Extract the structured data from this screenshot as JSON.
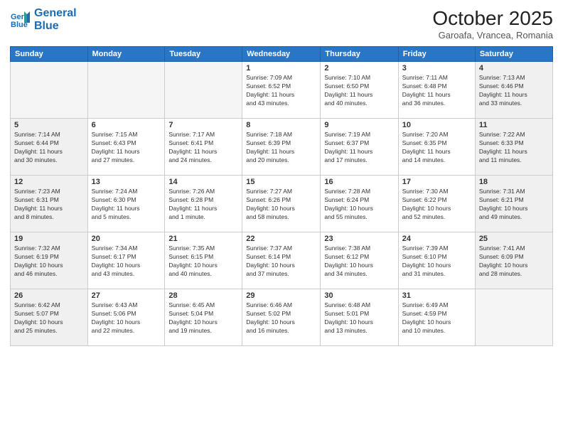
{
  "logo": {
    "line1": "General",
    "line2": "Blue"
  },
  "title": "October 2025",
  "location": "Garoafa, Vrancea, Romania",
  "headers": [
    "Sunday",
    "Monday",
    "Tuesday",
    "Wednesday",
    "Thursday",
    "Friday",
    "Saturday"
  ],
  "weeks": [
    [
      {
        "day": "",
        "info": "",
        "empty": true
      },
      {
        "day": "",
        "info": "",
        "empty": true
      },
      {
        "day": "",
        "info": "",
        "empty": true
      },
      {
        "day": "1",
        "info": "Sunrise: 7:09 AM\nSunset: 6:52 PM\nDaylight: 11 hours\nand 43 minutes."
      },
      {
        "day": "2",
        "info": "Sunrise: 7:10 AM\nSunset: 6:50 PM\nDaylight: 11 hours\nand 40 minutes."
      },
      {
        "day": "3",
        "info": "Sunrise: 7:11 AM\nSunset: 6:48 PM\nDaylight: 11 hours\nand 36 minutes."
      },
      {
        "day": "4",
        "info": "Sunrise: 7:13 AM\nSunset: 6:46 PM\nDaylight: 11 hours\nand 33 minutes.",
        "weekend": true
      }
    ],
    [
      {
        "day": "5",
        "info": "Sunrise: 7:14 AM\nSunset: 6:44 PM\nDaylight: 11 hours\nand 30 minutes.",
        "weekend": true
      },
      {
        "day": "6",
        "info": "Sunrise: 7:15 AM\nSunset: 6:43 PM\nDaylight: 11 hours\nand 27 minutes."
      },
      {
        "day": "7",
        "info": "Sunrise: 7:17 AM\nSunset: 6:41 PM\nDaylight: 11 hours\nand 24 minutes."
      },
      {
        "day": "8",
        "info": "Sunrise: 7:18 AM\nSunset: 6:39 PM\nDaylight: 11 hours\nand 20 minutes."
      },
      {
        "day": "9",
        "info": "Sunrise: 7:19 AM\nSunset: 6:37 PM\nDaylight: 11 hours\nand 17 minutes."
      },
      {
        "day": "10",
        "info": "Sunrise: 7:20 AM\nSunset: 6:35 PM\nDaylight: 11 hours\nand 14 minutes."
      },
      {
        "day": "11",
        "info": "Sunrise: 7:22 AM\nSunset: 6:33 PM\nDaylight: 11 hours\nand 11 minutes.",
        "weekend": true
      }
    ],
    [
      {
        "day": "12",
        "info": "Sunrise: 7:23 AM\nSunset: 6:31 PM\nDaylight: 11 hours\nand 8 minutes.",
        "weekend": true
      },
      {
        "day": "13",
        "info": "Sunrise: 7:24 AM\nSunset: 6:30 PM\nDaylight: 11 hours\nand 5 minutes."
      },
      {
        "day": "14",
        "info": "Sunrise: 7:26 AM\nSunset: 6:28 PM\nDaylight: 11 hours\nand 1 minute."
      },
      {
        "day": "15",
        "info": "Sunrise: 7:27 AM\nSunset: 6:26 PM\nDaylight: 10 hours\nand 58 minutes."
      },
      {
        "day": "16",
        "info": "Sunrise: 7:28 AM\nSunset: 6:24 PM\nDaylight: 10 hours\nand 55 minutes."
      },
      {
        "day": "17",
        "info": "Sunrise: 7:30 AM\nSunset: 6:22 PM\nDaylight: 10 hours\nand 52 minutes."
      },
      {
        "day": "18",
        "info": "Sunrise: 7:31 AM\nSunset: 6:21 PM\nDaylight: 10 hours\nand 49 minutes.",
        "weekend": true
      }
    ],
    [
      {
        "day": "19",
        "info": "Sunrise: 7:32 AM\nSunset: 6:19 PM\nDaylight: 10 hours\nand 46 minutes.",
        "weekend": true
      },
      {
        "day": "20",
        "info": "Sunrise: 7:34 AM\nSunset: 6:17 PM\nDaylight: 10 hours\nand 43 minutes."
      },
      {
        "day": "21",
        "info": "Sunrise: 7:35 AM\nSunset: 6:15 PM\nDaylight: 10 hours\nand 40 minutes."
      },
      {
        "day": "22",
        "info": "Sunrise: 7:37 AM\nSunset: 6:14 PM\nDaylight: 10 hours\nand 37 minutes."
      },
      {
        "day": "23",
        "info": "Sunrise: 7:38 AM\nSunset: 6:12 PM\nDaylight: 10 hours\nand 34 minutes."
      },
      {
        "day": "24",
        "info": "Sunrise: 7:39 AM\nSunset: 6:10 PM\nDaylight: 10 hours\nand 31 minutes."
      },
      {
        "day": "25",
        "info": "Sunrise: 7:41 AM\nSunset: 6:09 PM\nDaylight: 10 hours\nand 28 minutes.",
        "weekend": true
      }
    ],
    [
      {
        "day": "26",
        "info": "Sunrise: 6:42 AM\nSunset: 5:07 PM\nDaylight: 10 hours\nand 25 minutes.",
        "weekend": true
      },
      {
        "day": "27",
        "info": "Sunrise: 6:43 AM\nSunset: 5:06 PM\nDaylight: 10 hours\nand 22 minutes."
      },
      {
        "day": "28",
        "info": "Sunrise: 6:45 AM\nSunset: 5:04 PM\nDaylight: 10 hours\nand 19 minutes."
      },
      {
        "day": "29",
        "info": "Sunrise: 6:46 AM\nSunset: 5:02 PM\nDaylight: 10 hours\nand 16 minutes."
      },
      {
        "day": "30",
        "info": "Sunrise: 6:48 AM\nSunset: 5:01 PM\nDaylight: 10 hours\nand 13 minutes."
      },
      {
        "day": "31",
        "info": "Sunrise: 6:49 AM\nSunset: 4:59 PM\nDaylight: 10 hours\nand 10 minutes."
      },
      {
        "day": "",
        "info": "",
        "empty": true,
        "weekend": true
      }
    ]
  ]
}
